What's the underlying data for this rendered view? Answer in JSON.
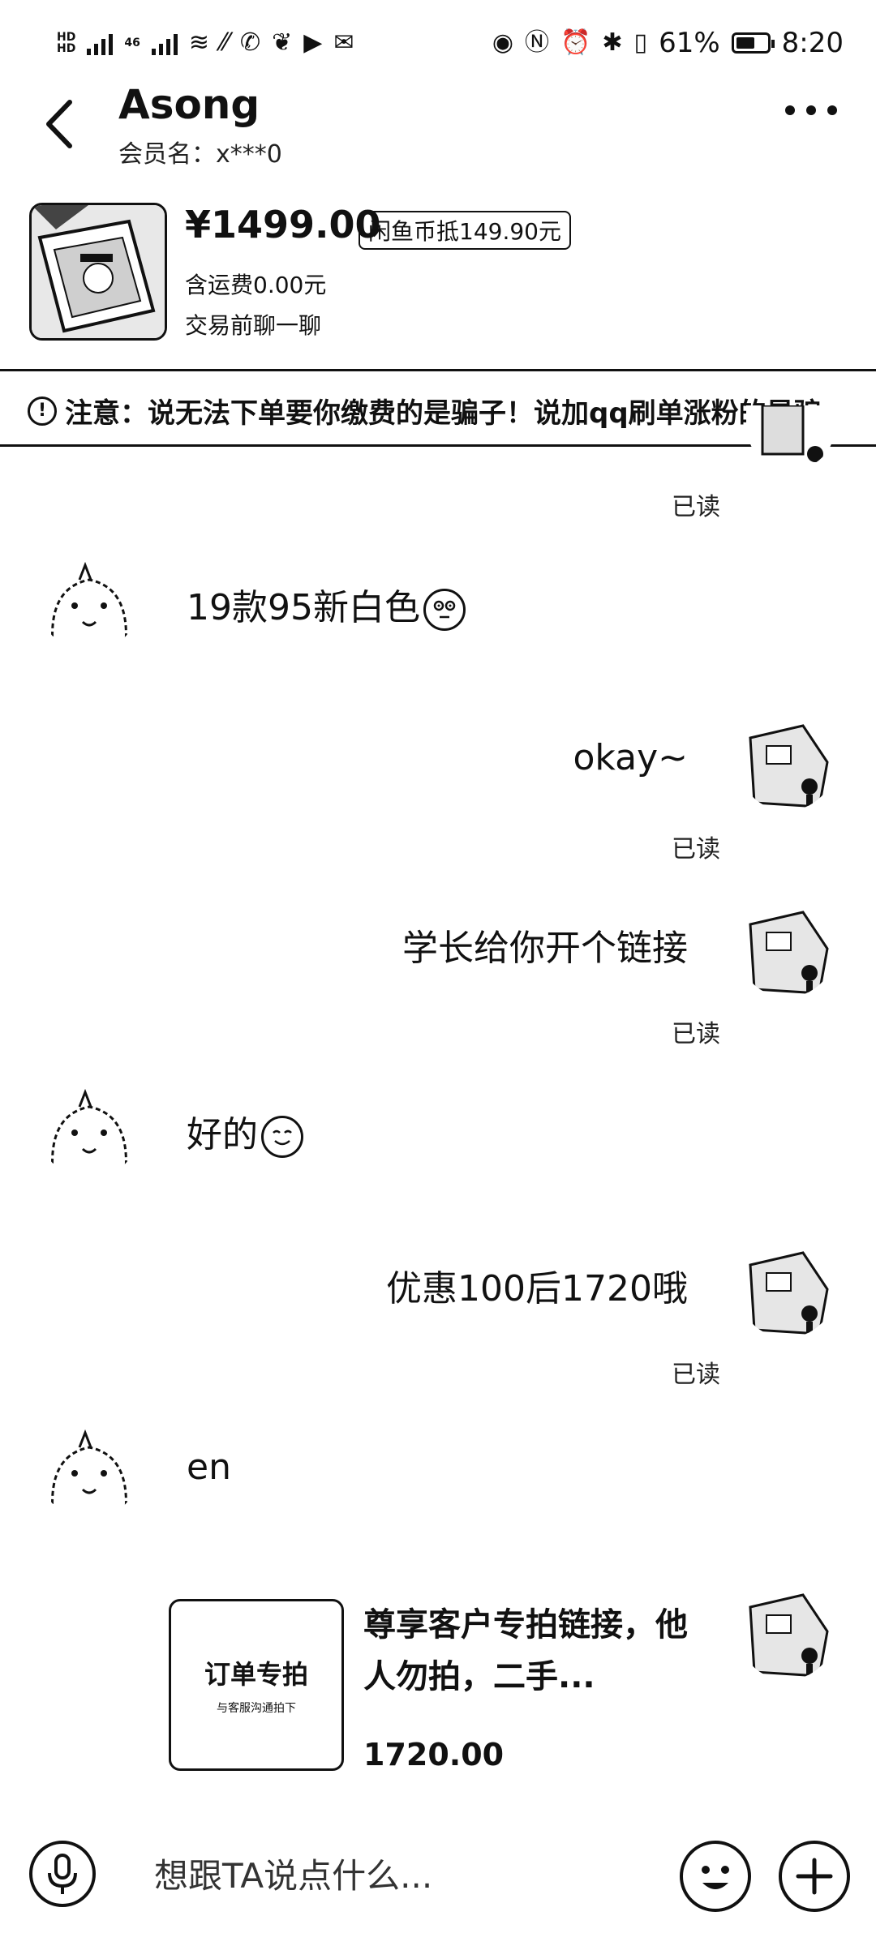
{
  "status_bar": {
    "battery": "61%",
    "battery_level": 0.61,
    "time": "8:20",
    "net_label": "46",
    "hd_label": "HD"
  },
  "header": {
    "title": "Asong",
    "member": "会员名：x***0"
  },
  "product": {
    "price": "¥1499.00",
    "coin_tag": "闲鱼币抵149.90元",
    "shipping": "含运费0.00元",
    "pre_chat": "交易前聊一聊"
  },
  "notice": {
    "text": "注意：说无法下单要你缴费的是骗子！说加qq刷单涨粉的是骗"
  },
  "messages": [
    {
      "side": "left",
      "text": "19款95新白色"
    },
    {
      "side": "right",
      "text": "okay~",
      "status": "已读"
    },
    {
      "side": "right",
      "text": "学长给你开个链接",
      "status": "已读"
    },
    {
      "side": "left",
      "text": "好的"
    },
    {
      "side": "right",
      "text": "优惠100后1720哦",
      "status": "已读"
    },
    {
      "side": "left",
      "text": "en"
    }
  ],
  "top_read": "已读",
  "card": {
    "image_title": "订单专拍",
    "image_sub": "与客服沟通拍下",
    "title": "尊享客户专拍链接，他人勿拍，二手...",
    "price": "1720.00"
  },
  "input": {
    "placeholder": "想跟TA说点什么..."
  },
  "icons": [
    "back-arrow-icon",
    "more-icon",
    "warning-icon",
    "emoji-icon",
    "mic-icon",
    "smile-icon",
    "plus-icon"
  ]
}
